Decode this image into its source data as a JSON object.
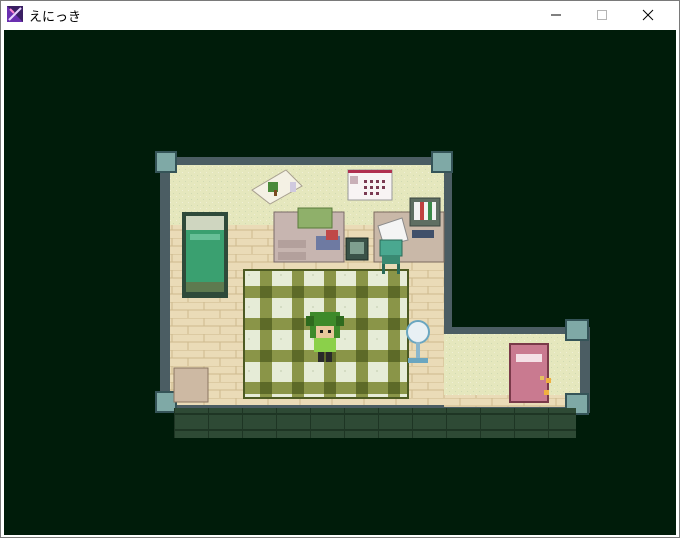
{
  "window": {
    "title": "えにっき",
    "icon": "app-icon",
    "controls": [
      "minimize-icon",
      "maximize-icon",
      "close-icon"
    ]
  },
  "game": {
    "scene": "room",
    "background_color": "#001c0a",
    "floor_color": "#eadbb7",
    "wall_color": "#e4e6b8",
    "rug_colors": [
      "#6f7b34",
      "#e6ecd7"
    ],
    "objects": [
      "bed",
      "poster",
      "calendar",
      "dresser",
      "desk",
      "chair",
      "tv",
      "electric-fan",
      "door",
      "player-character"
    ]
  }
}
